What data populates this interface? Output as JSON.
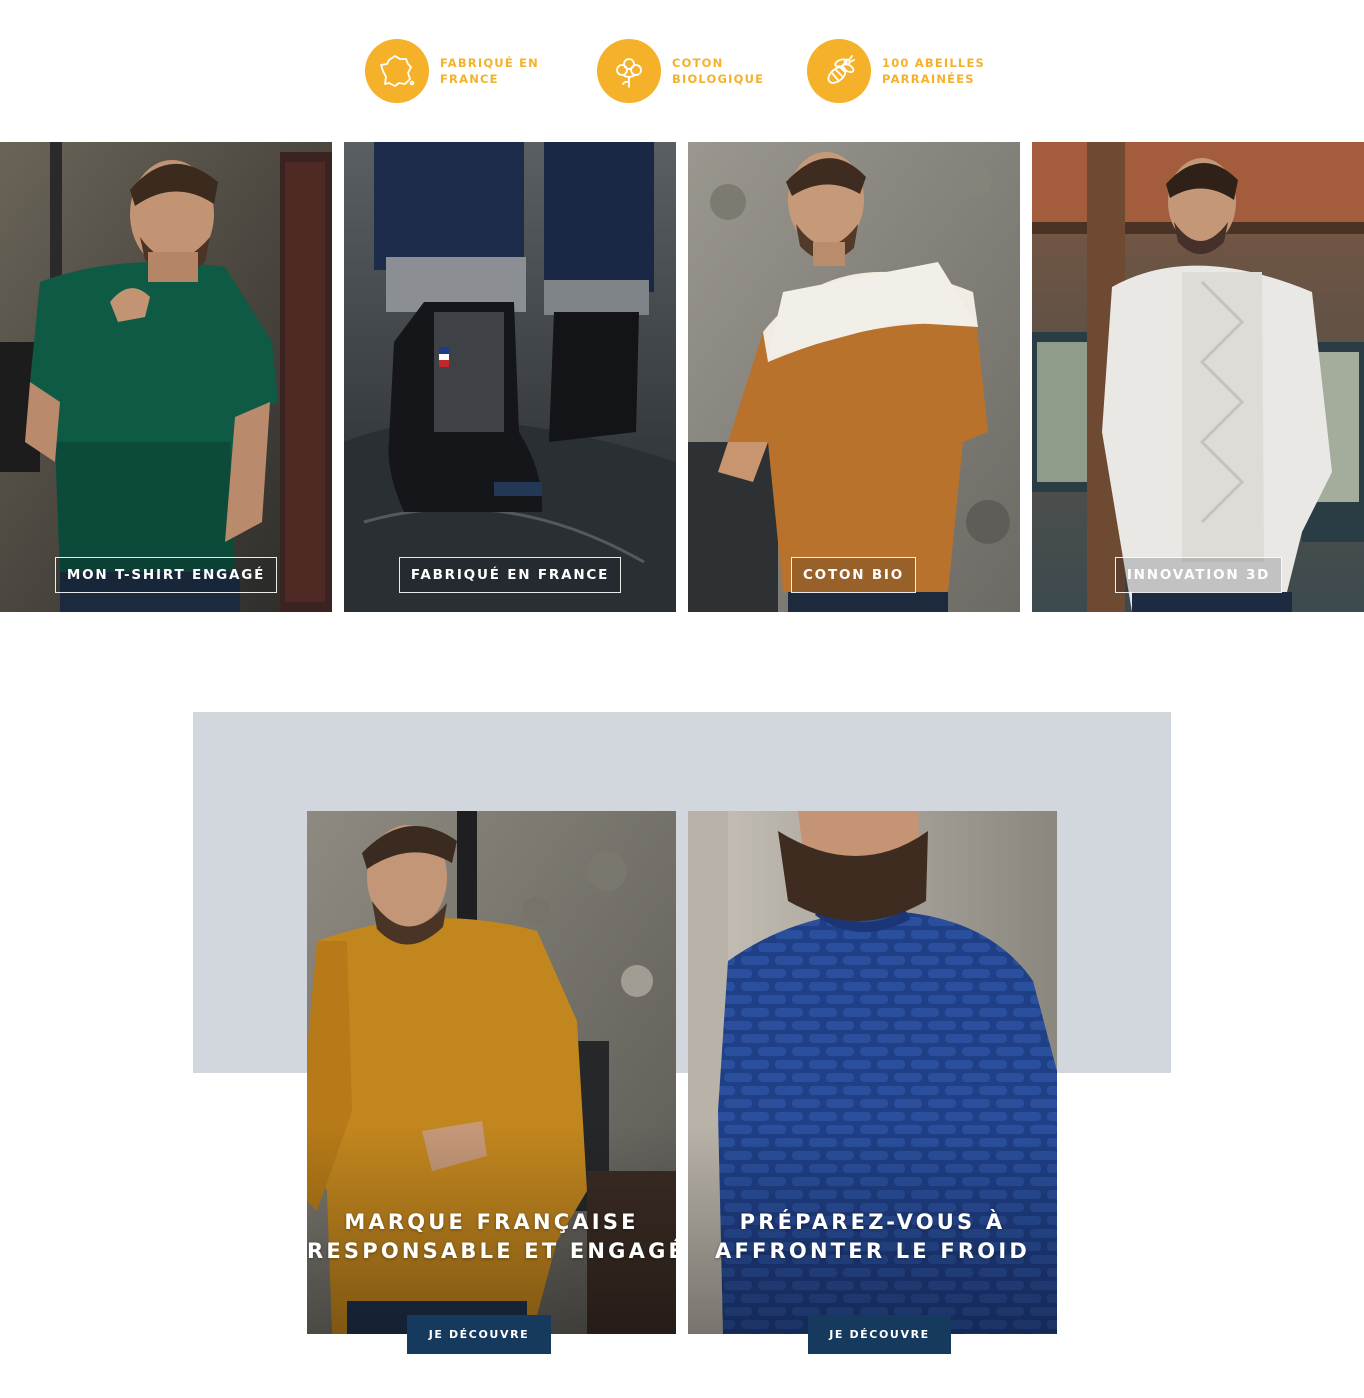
{
  "colors": {
    "accent": "#f5b12a",
    "button": "#163a5e",
    "promo_background": "#d1d7dc"
  },
  "features": [
    {
      "icon": "france-map-icon",
      "line1": "FABRIQUÉ EN",
      "line2": "FRANCE"
    },
    {
      "icon": "cotton-flower-icon",
      "line1": "COTON",
      "line2": "BIOLOGIQUE"
    },
    {
      "icon": "bee-icon",
      "line1": "100 ABEILLES",
      "line2": "PARRAINÉES"
    }
  ],
  "tiles": [
    {
      "label": "MON T-SHIRT ENGAGÉ",
      "image": "man-green-tshirt-photo"
    },
    {
      "label": "FABRIQUÉ EN FRANCE",
      "image": "black-rain-boots-photo"
    },
    {
      "label": "COTON BIO",
      "image": "man-colorblock-sweatshirt-photo"
    },
    {
      "label": "INNOVATION 3D",
      "image": "man-white-cable-knit-photo"
    }
  ],
  "promos": [
    {
      "line1": "MARQUE FRANÇAISE",
      "line2": "RESPONSABLE ET ENGAGÉE",
      "button": "JE DÉCOUVRE",
      "image": "man-mustard-sweater-photo"
    },
    {
      "line1": "PRÉPAREZ-VOUS À",
      "line2": "AFFRONTER LE FROID",
      "button": "JE DÉCOUVRE",
      "image": "man-navy-knit-sweater-photo"
    }
  ]
}
